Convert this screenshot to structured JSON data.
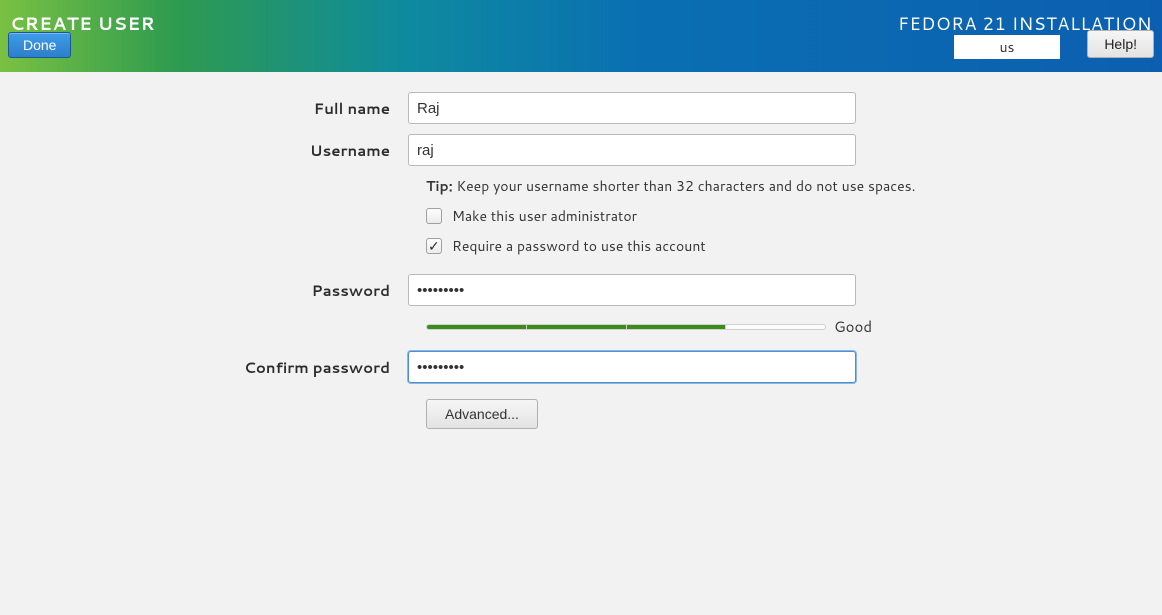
{
  "header": {
    "title": "CREATE USER",
    "done": "Done",
    "install_title": "FEDORA 21 INSTALLATION",
    "keyboard": "us",
    "help": "Help!"
  },
  "form": {
    "fullname_label": "Full name",
    "fullname_value": "Raj",
    "username_label": "Username",
    "username_value": "raj",
    "tip_label": "Tip:",
    "tip_text": " Keep your username shorter than 32 characters and do not use spaces.",
    "admin_label": "Make this user administrator",
    "require_pw_label": "Require a password to use this account",
    "password_label": "Password",
    "password_value": "•••••••••",
    "strength_text": "Good",
    "confirm_label": "Confirm password",
    "confirm_value": "•••••••••",
    "advanced": "Advanced..."
  }
}
